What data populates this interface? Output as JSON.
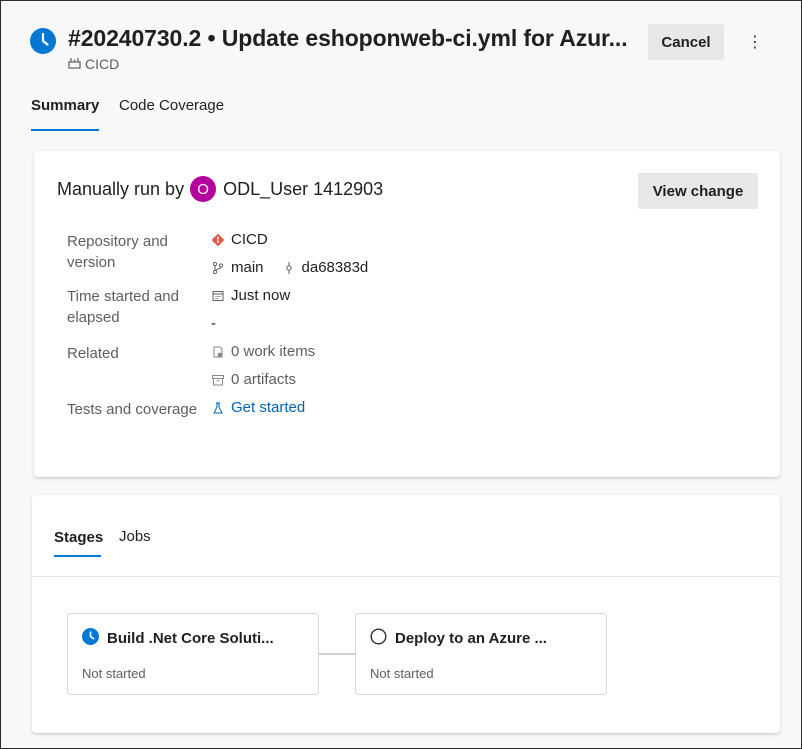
{
  "header": {
    "title": "#20240730.2 • Update eshoponweb-ci.yml for Azur...",
    "pipeline": "CICD",
    "cancel_label": "Cancel",
    "more_label": "⋮",
    "status": "queued"
  },
  "tabs": [
    {
      "label": "Summary",
      "selected": true
    },
    {
      "label": "Code Coverage",
      "selected": false
    }
  ],
  "summary": {
    "run_by_prefix": "Manually run by",
    "avatar_initial": "O",
    "user": "ODL_User 1412903",
    "view_change_label": "View change",
    "repo_label": "Repository and version",
    "repo_label_line1": "Repository and",
    "repo_label_line2": "version",
    "repo_name": "CICD",
    "branch": "main",
    "commit": "da68383d",
    "time_label_line1": "Time started and",
    "time_label_line2": "elapsed",
    "time_started": "Just now",
    "elapsed": "-",
    "related_label": "Related",
    "work_items": "0 work items",
    "artifacts": "0 artifacts",
    "tests_label": "Tests and coverage",
    "tests_link": "Get started"
  },
  "stages_panel": {
    "tabs": [
      {
        "label": "Stages",
        "selected": true
      },
      {
        "label": "Jobs",
        "selected": false
      }
    ],
    "stages": [
      {
        "name": "Build .Net Core Soluti...",
        "status": "Not started",
        "icon": "clock-icon"
      },
      {
        "name": "Deploy to an Azure ...",
        "status": "Not started",
        "icon": "circle-icon"
      }
    ]
  },
  "colors": {
    "accent": "#0078d4",
    "avatar": "#b4009e",
    "git": "#e05d44",
    "link": "#0063b1"
  }
}
